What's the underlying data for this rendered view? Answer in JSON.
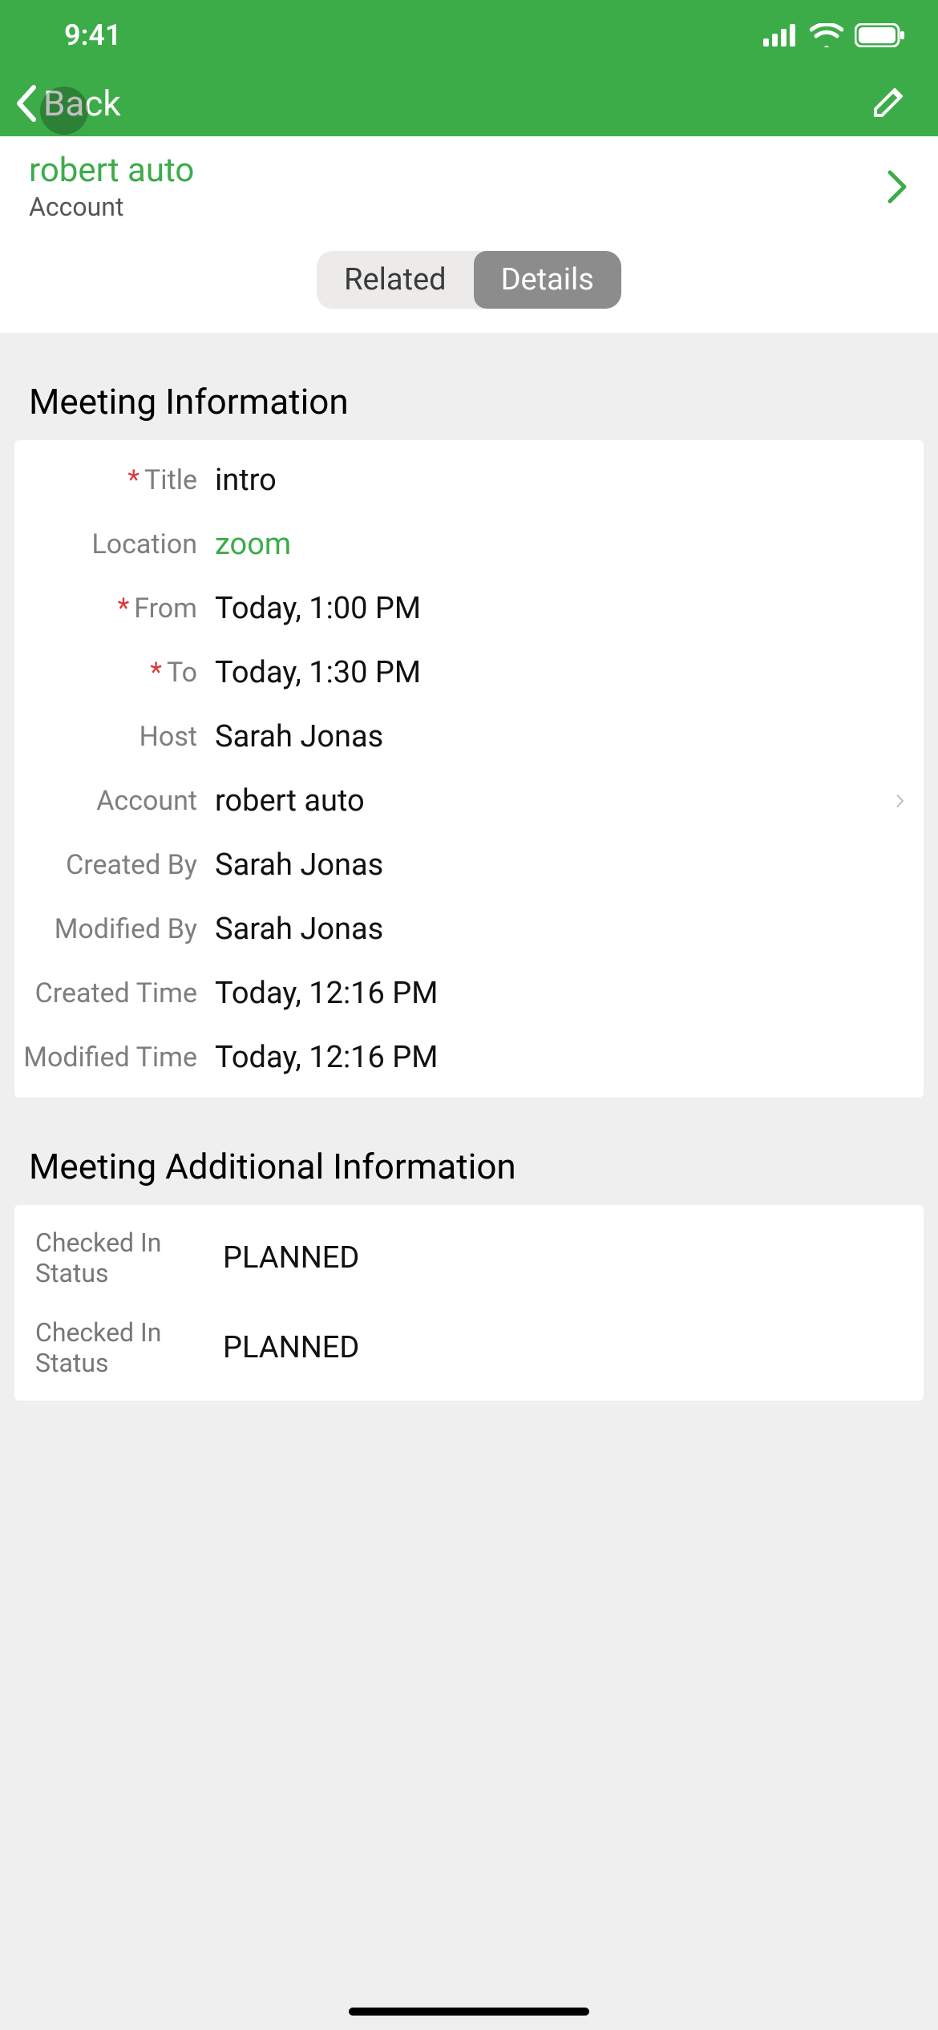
{
  "status": {
    "time": "9:41"
  },
  "nav": {
    "back_label": "Back"
  },
  "account_header": {
    "name": "robert auto",
    "sublabel": "Account"
  },
  "tabs": {
    "related": "Related",
    "details": "Details"
  },
  "sections": {
    "meeting_info_title": "Meeting Information",
    "meeting_additional_title": "Meeting Additional Information"
  },
  "fields": {
    "title": {
      "label": "Title",
      "value": "intro",
      "required": true
    },
    "location": {
      "label": "Location",
      "value": "zoom",
      "required": false
    },
    "from": {
      "label": "From",
      "value": "Today, 1:00 PM",
      "required": true
    },
    "to": {
      "label": "To",
      "value": "Today, 1:30 PM",
      "required": true
    },
    "host": {
      "label": "Host",
      "value": "Sarah Jonas",
      "required": false
    },
    "account": {
      "label": "Account",
      "value": "robert auto",
      "required": false
    },
    "created_by": {
      "label": "Created By",
      "value": "Sarah Jonas",
      "required": false
    },
    "modified_by": {
      "label": "Modified By",
      "value": "Sarah Jonas",
      "required": false
    },
    "created_time": {
      "label": "Created Time",
      "value": "Today, 12:16 PM",
      "required": false
    },
    "modified_time": {
      "label": "Modified Time",
      "value": "Today, 12:16 PM",
      "required": false
    }
  },
  "additional": {
    "checked_in_1": {
      "label": "Checked In Status",
      "value": "PLANNED"
    },
    "checked_in_2": {
      "label": "Checked In Status",
      "value": "PLANNED"
    }
  }
}
